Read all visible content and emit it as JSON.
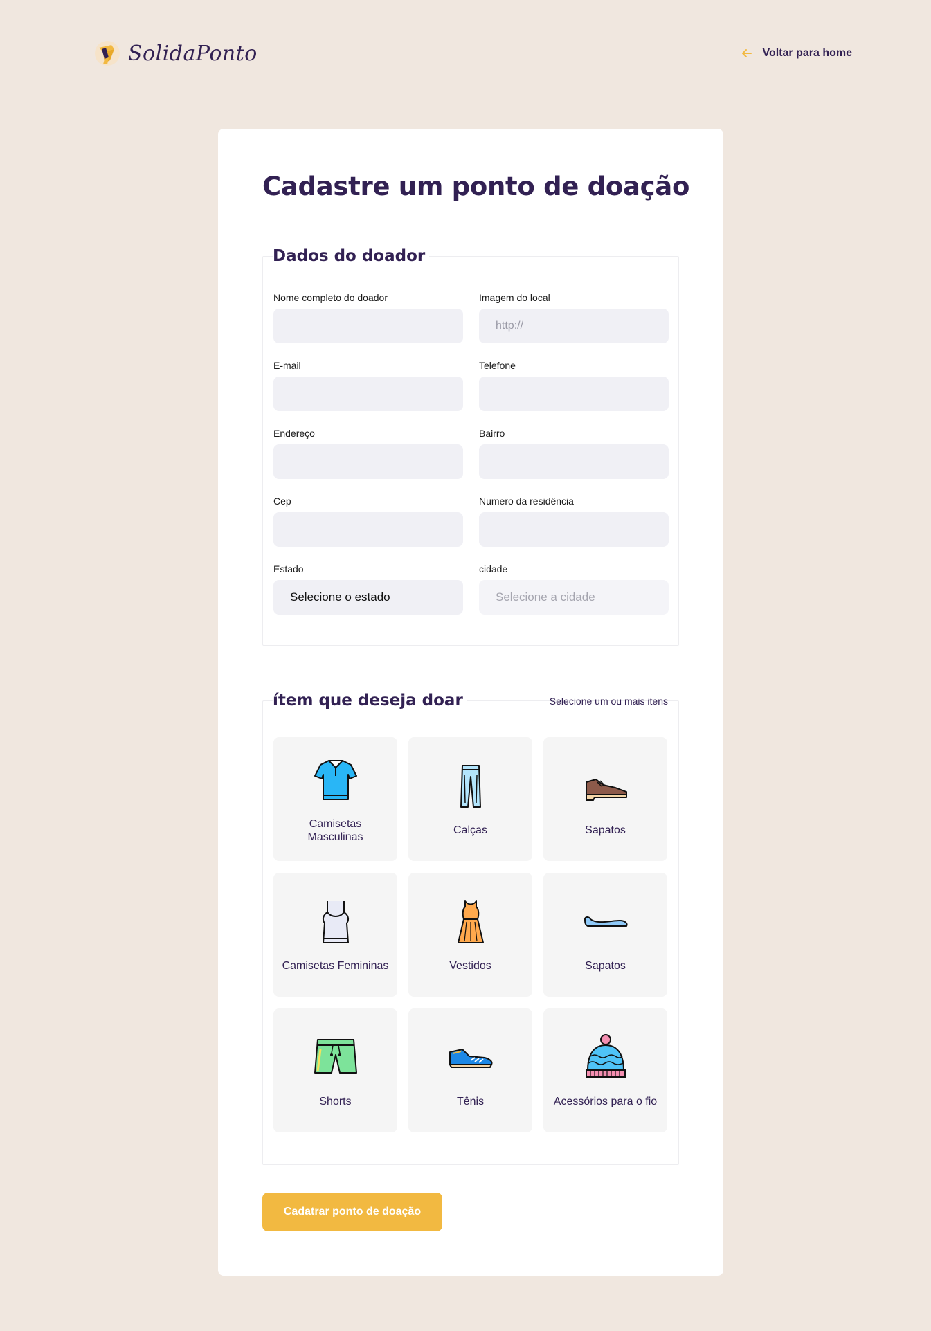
{
  "header": {
    "logo_text": "SolidaPonto",
    "back_label": "Voltar para home"
  },
  "page_title": "Cadastre um ponto de doação",
  "donor_section": {
    "legend": "Dados do doador",
    "fields": {
      "name": {
        "label": "Nome completo do doador",
        "value": ""
      },
      "image": {
        "label": "Imagem do local",
        "value": "",
        "placeholder": "http://"
      },
      "email": {
        "label": "E-mail",
        "value": ""
      },
      "phone": {
        "label": "Telefone",
        "value": ""
      },
      "address": {
        "label": "Endereço",
        "value": ""
      },
      "district": {
        "label": "Bairro",
        "value": ""
      },
      "zip": {
        "label": "Cep",
        "value": ""
      },
      "number": {
        "label": "Numero da residência",
        "value": ""
      },
      "state": {
        "label": "Estado",
        "selected": "Selecione o estado"
      },
      "city": {
        "label": "cidade",
        "selected": "Selecione a cidade"
      }
    }
  },
  "items_section": {
    "legend": "ítem que deseja doar",
    "hint": "Selecione um ou mais itens",
    "items": [
      {
        "label": "Camisetas Masculinas",
        "icon": "polo-shirt-icon"
      },
      {
        "label": "Calças",
        "icon": "pants-icon"
      },
      {
        "label": "Sapatos",
        "icon": "dress-shoe-icon"
      },
      {
        "label": "Camisetas Femininas",
        "icon": "tank-top-icon"
      },
      {
        "label": "Vestidos",
        "icon": "dress-icon"
      },
      {
        "label": "Sapatos",
        "icon": "flat-shoe-icon"
      },
      {
        "label": "Shorts",
        "icon": "shorts-icon"
      },
      {
        "label": "Tênis",
        "icon": "sneaker-icon"
      },
      {
        "label": "Acessórios para o fio",
        "icon": "beanie-icon"
      }
    ]
  },
  "submit_label": "Cadatrar ponto de doação",
  "colors": {
    "background": "#F0E7DF",
    "primary_text": "#322153",
    "accent": "#F2B941",
    "input_bg": "#F0F0F5",
    "tile_bg": "#F5F5F5"
  }
}
